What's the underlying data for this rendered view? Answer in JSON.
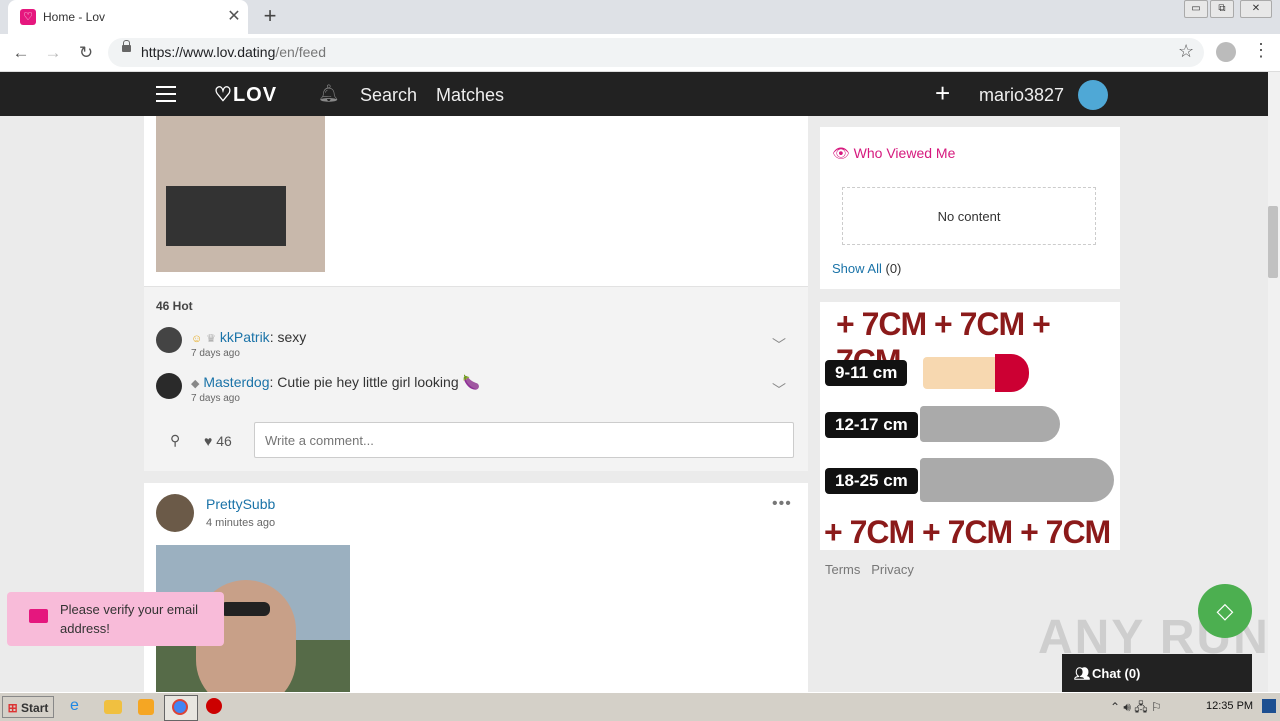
{
  "browser": {
    "tab_title": "Home - Lov",
    "tab_close": "✕",
    "new_tab": "+",
    "url_host": "https://www.lov.dating",
    "url_path": "/en/feed",
    "window_buttons": [
      "▭",
      "⧉",
      "✕"
    ]
  },
  "header": {
    "logo": "LOV",
    "nav": [
      "Search",
      "Matches"
    ],
    "add": "+",
    "username": "mario3827"
  },
  "feed": {
    "post1": {
      "hot_count": "46 Hot",
      "comments": [
        {
          "author": "kkPatrik",
          "text": ": sexy",
          "time": "7 days ago"
        },
        {
          "author": "Masterdog",
          "text": ": Cutie pie hey little girl looking 🍆",
          "time": "7 days ago"
        }
      ],
      "like_count": "46",
      "comment_placeholder": "Write a comment..."
    },
    "post2": {
      "author": "PrettySubb",
      "time": "4 minutes ago",
      "menu": "•••"
    }
  },
  "sidebar": {
    "who_viewed_title": "Who Viewed Me",
    "no_content": "No content",
    "show_all_label": "Show All",
    "show_all_count": "(0)",
    "ad": {
      "top_text": "+ 7CM + 7CM + 7CM",
      "sizes": [
        "9-11 cm",
        "12-17 cm",
        "18-25 cm"
      ],
      "bottom_text": "+ 7CM + 7CM + 7CM"
    },
    "links": [
      "Terms",
      "Privacy"
    ]
  },
  "toast": {
    "text": "Please verify your email address!"
  },
  "chat": {
    "label": "Chat (0)"
  },
  "watermark": "ANY RUN",
  "taskbar": {
    "start": "Start",
    "time": "12:35 PM"
  }
}
